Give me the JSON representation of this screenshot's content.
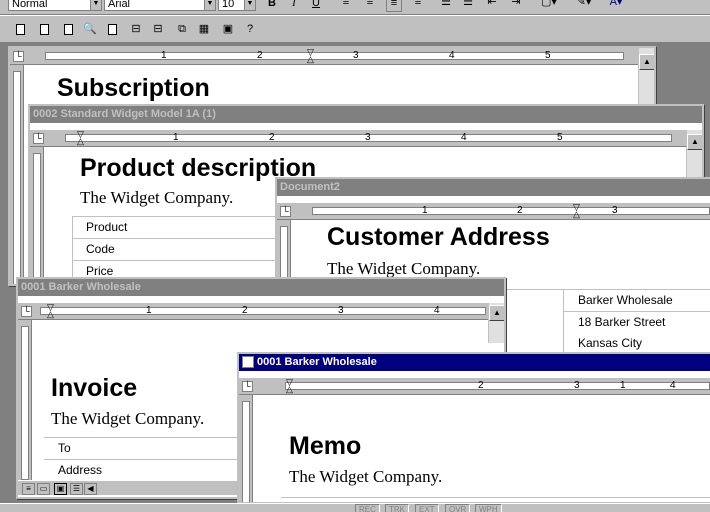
{
  "formatting": {
    "style": "Normal",
    "font": "Arial",
    "size": "10",
    "bold": "B",
    "italic": "I",
    "underline": "U"
  },
  "ruler_numbers": [
    "1",
    "2",
    "3",
    "4",
    "5"
  ],
  "windows": {
    "subscription": {
      "heading": "Subscription"
    },
    "widget": {
      "title": "0002 Standard Widget Model 1A (1)",
      "heading": "Product description",
      "company": "The Widget Company.",
      "rows": [
        "Product",
        "Code",
        "Price"
      ]
    },
    "document2": {
      "title": "Document2",
      "heading": "Customer Address",
      "company": "The Widget Company.",
      "address": [
        "Barker Wholesale",
        "18 Barker Street",
        "Kansas City"
      ]
    },
    "invoice": {
      "title": "0001 Barker Wholesale",
      "heading": "Invoice",
      "company": "The Widget Company.",
      "rows": [
        "To",
        "Address"
      ]
    },
    "memo": {
      "title": "0001 Barker Wholesale",
      "heading": "Memo",
      "company": "The Widget Company."
    }
  },
  "status": {
    "indicators": [
      "REC",
      "TRK",
      "EXT",
      "OVR",
      "WPH"
    ]
  }
}
